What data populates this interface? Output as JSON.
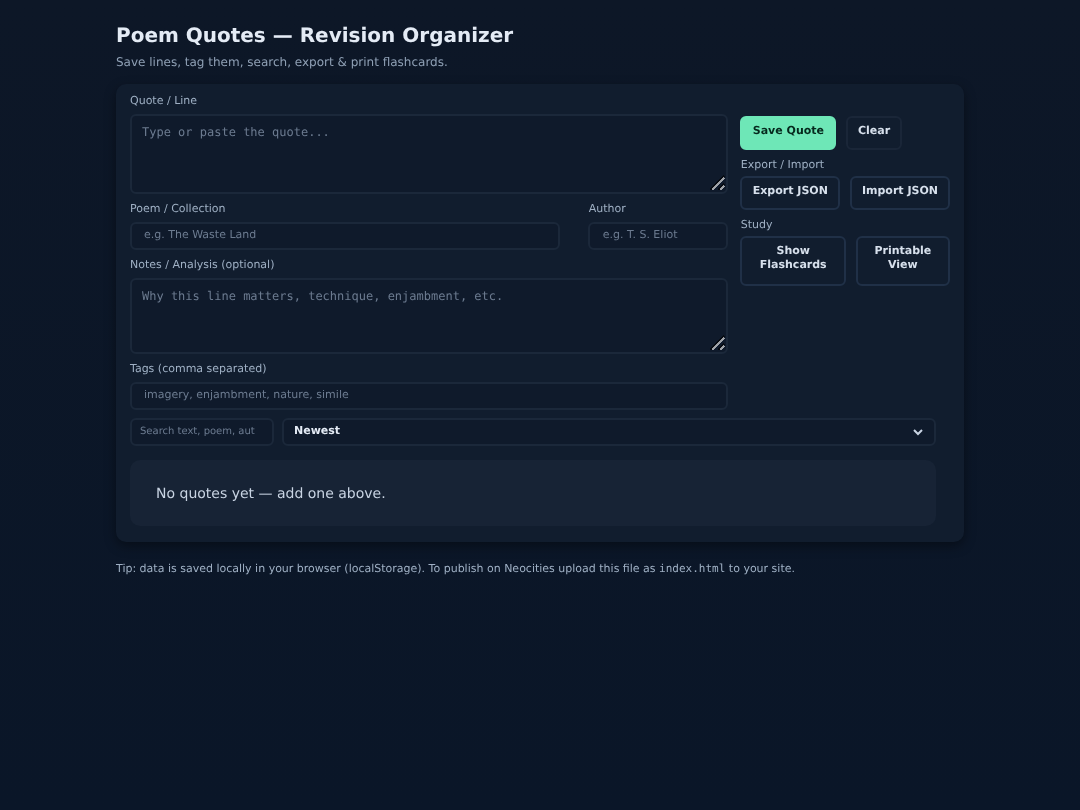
{
  "header": {
    "title": "Poem Quotes — Revision Organizer",
    "subtitle": "Save lines, tag them, search, export & print flashcards."
  },
  "form": {
    "quote": {
      "label": "Quote / Line",
      "placeholder": "Type or paste the quote..."
    },
    "poem": {
      "label": "Poem / Collection",
      "placeholder": "e.g. The Waste Land"
    },
    "author": {
      "label": "Author",
      "placeholder": "e.g. T. S. Eliot"
    },
    "notes": {
      "label": "Notes / Analysis (optional)",
      "placeholder": "Why this line matters, technique, enjambment, etc."
    },
    "tags": {
      "label": "Tags (comma separated)",
      "placeholder": "imagery, enjambment, nature, simile"
    }
  },
  "actions": [
    {
      "buttons": [
        {
          "label": "Save Quote",
          "kind": "primary"
        },
        {
          "label": "Clear",
          "kind": "plain"
        }
      ]
    },
    {
      "title": "Export / Import",
      "buttons": [
        {
          "label": "Export JSON",
          "kind": "outline"
        },
        {
          "label": "Import JSON",
          "kind": "outline"
        }
      ]
    },
    {
      "title": "Study",
      "buttons": [
        {
          "label": "Show Flashcards",
          "kind": "outline"
        },
        {
          "label": "Printable View",
          "kind": "outline"
        }
      ]
    }
  ],
  "search": {
    "placeholder": "Search text, poem, aut"
  },
  "sort": {
    "value": "Newest"
  },
  "empty_message": "No quotes yet — add one above.",
  "tip": {
    "before": "Tip: data is saved locally in your browser (localStorage). To publish on Neocities upload this file as ",
    "code": "index.html",
    "after": " to your site."
  }
}
